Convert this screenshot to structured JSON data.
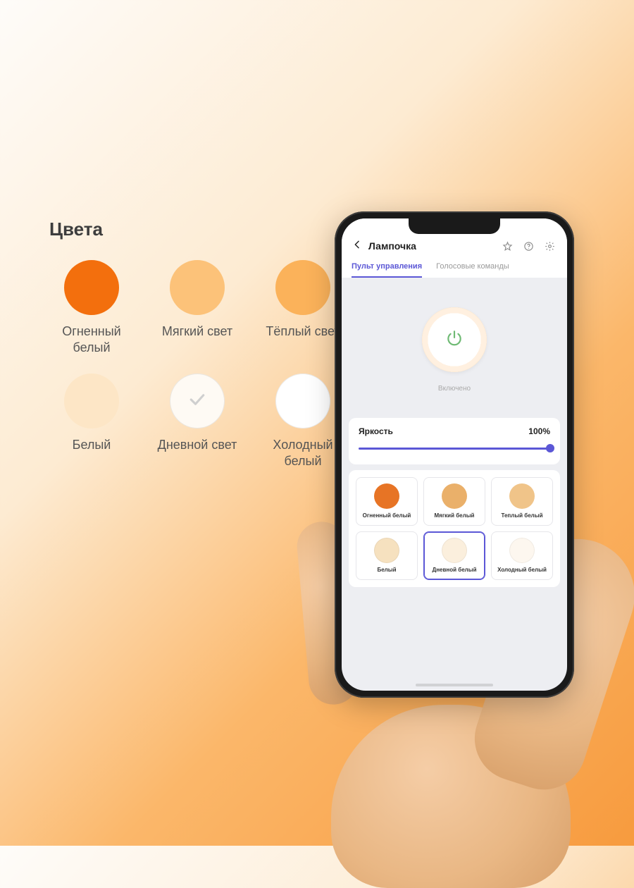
{
  "palette": {
    "title": "Цвета",
    "items": [
      {
        "label": "Огненный\nбелый",
        "color": "#f36f0d",
        "border": false,
        "checked": false
      },
      {
        "label": "Мягкий свет",
        "color": "#fcc279",
        "border": false,
        "checked": false
      },
      {
        "label": "Тёплый свет",
        "color": "#fbb25a",
        "border": false,
        "checked": false
      },
      {
        "label": "Белый",
        "color": "#fde6c6",
        "border": false,
        "checked": false
      },
      {
        "label": "Дневной свет",
        "color": "#fefaf4",
        "border": true,
        "checked": true
      },
      {
        "label": "Холодный\nбелый",
        "color": "#ffffff",
        "border": true,
        "checked": false
      }
    ]
  },
  "app": {
    "header": {
      "title": "Лампочка"
    },
    "tabs": [
      {
        "label": "Пульт управления",
        "active": true
      },
      {
        "label": "Голосовые команды",
        "active": false
      }
    ],
    "power": {
      "status": "Включено"
    },
    "brightness": {
      "label": "Яркость",
      "value_text": "100%",
      "value_pct": 100
    },
    "colors": [
      {
        "label": "Огненный белый",
        "color": "#e77425",
        "selected": false
      },
      {
        "label": "Мягкий белый",
        "color": "#eab06a",
        "selected": false
      },
      {
        "label": "Теплый белый",
        "color": "#f0c489",
        "selected": false
      },
      {
        "label": "Белый",
        "color": "#f6e1bf",
        "selected": false
      },
      {
        "label": "Дневной белый",
        "color": "#fbefdd",
        "selected": true
      },
      {
        "label": "Холодный белый",
        "color": "#fdf7ef",
        "selected": false
      }
    ]
  },
  "colors_theme": {
    "accent": "#5b57d6",
    "power_on": "#6fba74"
  }
}
